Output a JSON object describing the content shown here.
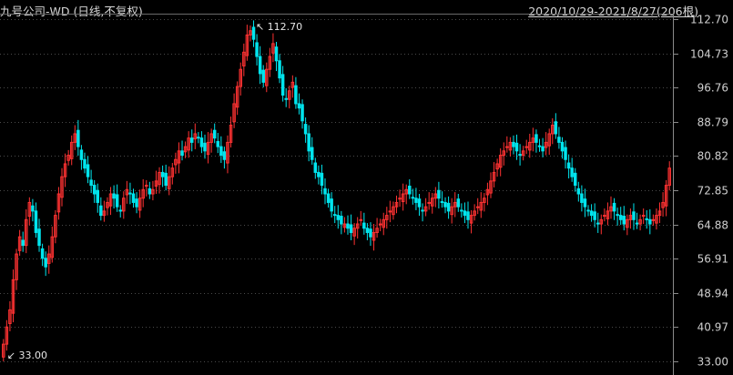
{
  "header": {
    "title": "九号公司-WD (日线,不复权)",
    "range": "2020/10/29-2021/8/27(206根)"
  },
  "colors": {
    "up": "#ff3232",
    "down": "#00e5ee",
    "grid": "#4a4a4a",
    "axis": "#8a8a8a"
  },
  "chart_data": {
    "type": "candlestick",
    "title": "九号公司-WD (日线,不复权)",
    "date_range": "2020/10/29-2021/8/27",
    "bar_count_label": "206根",
    "ylim": [
      33.0,
      112.7
    ],
    "yticks": [
      "112.70",
      "104.73",
      "96.76",
      "88.79",
      "80.82",
      "72.85",
      "64.88",
      "56.91",
      "48.94",
      "40.97",
      "33.00"
    ],
    "grid": true,
    "annotations": {
      "high": "112.70",
      "low": "33.00"
    },
    "series": [
      {
        "name": "close",
        "values": [
          37,
          41,
          45,
          52,
          58,
          62,
          60,
          66,
          70,
          68,
          63,
          60,
          57,
          55,
          58,
          62,
          67,
          72,
          76,
          79,
          81,
          84,
          86,
          83,
          80,
          78,
          76,
          74,
          72,
          70,
          67,
          68,
          70,
          72,
          71,
          69,
          68,
          71,
          73,
          72,
          70,
          69,
          71,
          73,
          74,
          72,
          73,
          75,
          77,
          76,
          74,
          76,
          78,
          80,
          82,
          81,
          83,
          85,
          84,
          86,
          85,
          83,
          82,
          84,
          86,
          85,
          83,
          81,
          80,
          84,
          88,
          93,
          97,
          101,
          105,
          109,
          110,
          108,
          104,
          100,
          98,
          101,
          104,
          107,
          103,
          99,
          95,
          94,
          96,
          98,
          93,
          92,
          89,
          86,
          82,
          80,
          77,
          76,
          74,
          72,
          70,
          68,
          67,
          66,
          65,
          65,
          64,
          63,
          64,
          65,
          66,
          64,
          63,
          62,
          63,
          64,
          65,
          66,
          67,
          68,
          69,
          70,
          71,
          72,
          73,
          72,
          71,
          70,
          69,
          68,
          69,
          70,
          71,
          72,
          71,
          70,
          69,
          68,
          69,
          70,
          69,
          68,
          67,
          66,
          67,
          68,
          69,
          70,
          71,
          73,
          75,
          77,
          79,
          81,
          82,
          83,
          84,
          83,
          82,
          81,
          82,
          83,
          84,
          85,
          84,
          83,
          82,
          84,
          86,
          88,
          86,
          84,
          82,
          80,
          78,
          76,
          74,
          72,
          70,
          69,
          68,
          67,
          66,
          65,
          66,
          67,
          68,
          69,
          68,
          67,
          66,
          65,
          66,
          67,
          66,
          65,
          66,
          67,
          66,
          65,
          66,
          67,
          68,
          70,
          74,
          78
        ]
      }
    ]
  }
}
